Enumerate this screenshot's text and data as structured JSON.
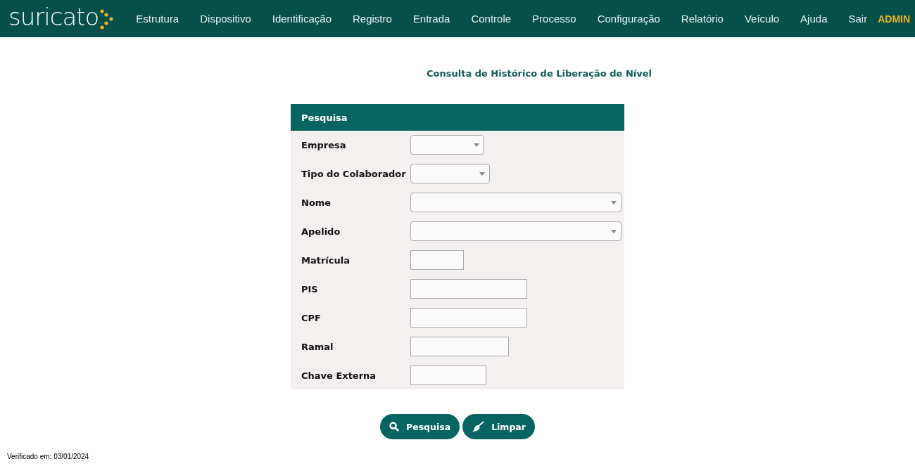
{
  "header": {
    "logo": "suricato",
    "menu": [
      {
        "label": "Estrutura"
      },
      {
        "label": "Dispositivo"
      },
      {
        "label": "Identificação"
      },
      {
        "label": "Registro"
      },
      {
        "label": "Entrada"
      },
      {
        "label": "Controle"
      },
      {
        "label": "Processo"
      },
      {
        "label": "Configuração"
      },
      {
        "label": "Relatório"
      },
      {
        "label": "Veículo"
      },
      {
        "label": "Ajuda"
      },
      {
        "label": "Sair"
      }
    ],
    "user": "ADMIN"
  },
  "page_title": "Consulta de Histórico de Liberação de Nível",
  "search_panel": {
    "title": "Pesquisa",
    "fields": [
      {
        "label": "Empresa",
        "kind": "select"
      },
      {
        "label": "Tipo do Colaborador",
        "kind": "select"
      },
      {
        "label": "Nome",
        "kind": "select"
      },
      {
        "label": "Apelido",
        "kind": "select"
      },
      {
        "label": "Matrícula",
        "kind": "text"
      },
      {
        "label": "PIS",
        "kind": "text"
      },
      {
        "label": "CPF",
        "kind": "text"
      },
      {
        "label": "Ramal",
        "kind": "text"
      },
      {
        "label": "Chave Externa",
        "kind": "text"
      }
    ]
  },
  "buttons": [
    {
      "label": "Pesquisa",
      "kind": "search"
    },
    {
      "label": "Limpar",
      "kind": "clear"
    }
  ],
  "footer": "Verificado em: 03/01/2024"
}
